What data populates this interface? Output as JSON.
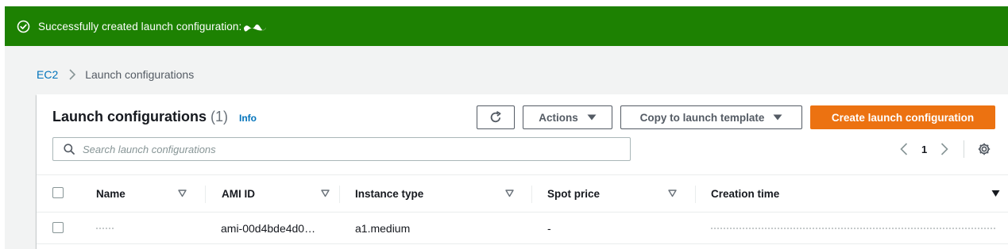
{
  "flash": {
    "message": "Successfully created launch configuration:",
    "status_color": "#1d8102"
  },
  "breadcrumb": {
    "root": "EC2",
    "current": "Launch configurations"
  },
  "panel": {
    "title": "Launch configurations",
    "count": "(1)",
    "info": "Info"
  },
  "toolbar": {
    "actions_label": "Actions",
    "copy_label": "Copy to launch template",
    "create_label": "Create launch configuration",
    "accent_color": "#ec7211"
  },
  "search": {
    "placeholder": "Search launch configurations"
  },
  "pagination": {
    "current_page": "1"
  },
  "table": {
    "columns": [
      "Name",
      "AMI ID",
      "Instance type",
      "Spot price",
      "Creation time"
    ],
    "rows": [
      {
        "ami_id": "ami-00d4bde4d0…",
        "instance_type": "a1.medium",
        "spot_price": "-"
      }
    ]
  },
  "icons": [
    "check-circle-icon",
    "chevron-right-icon",
    "refresh-icon",
    "caret-down-icon",
    "search-icon",
    "chevron-left-icon",
    "settings-icon",
    "sort-icon",
    "sort-descending-icon"
  ]
}
